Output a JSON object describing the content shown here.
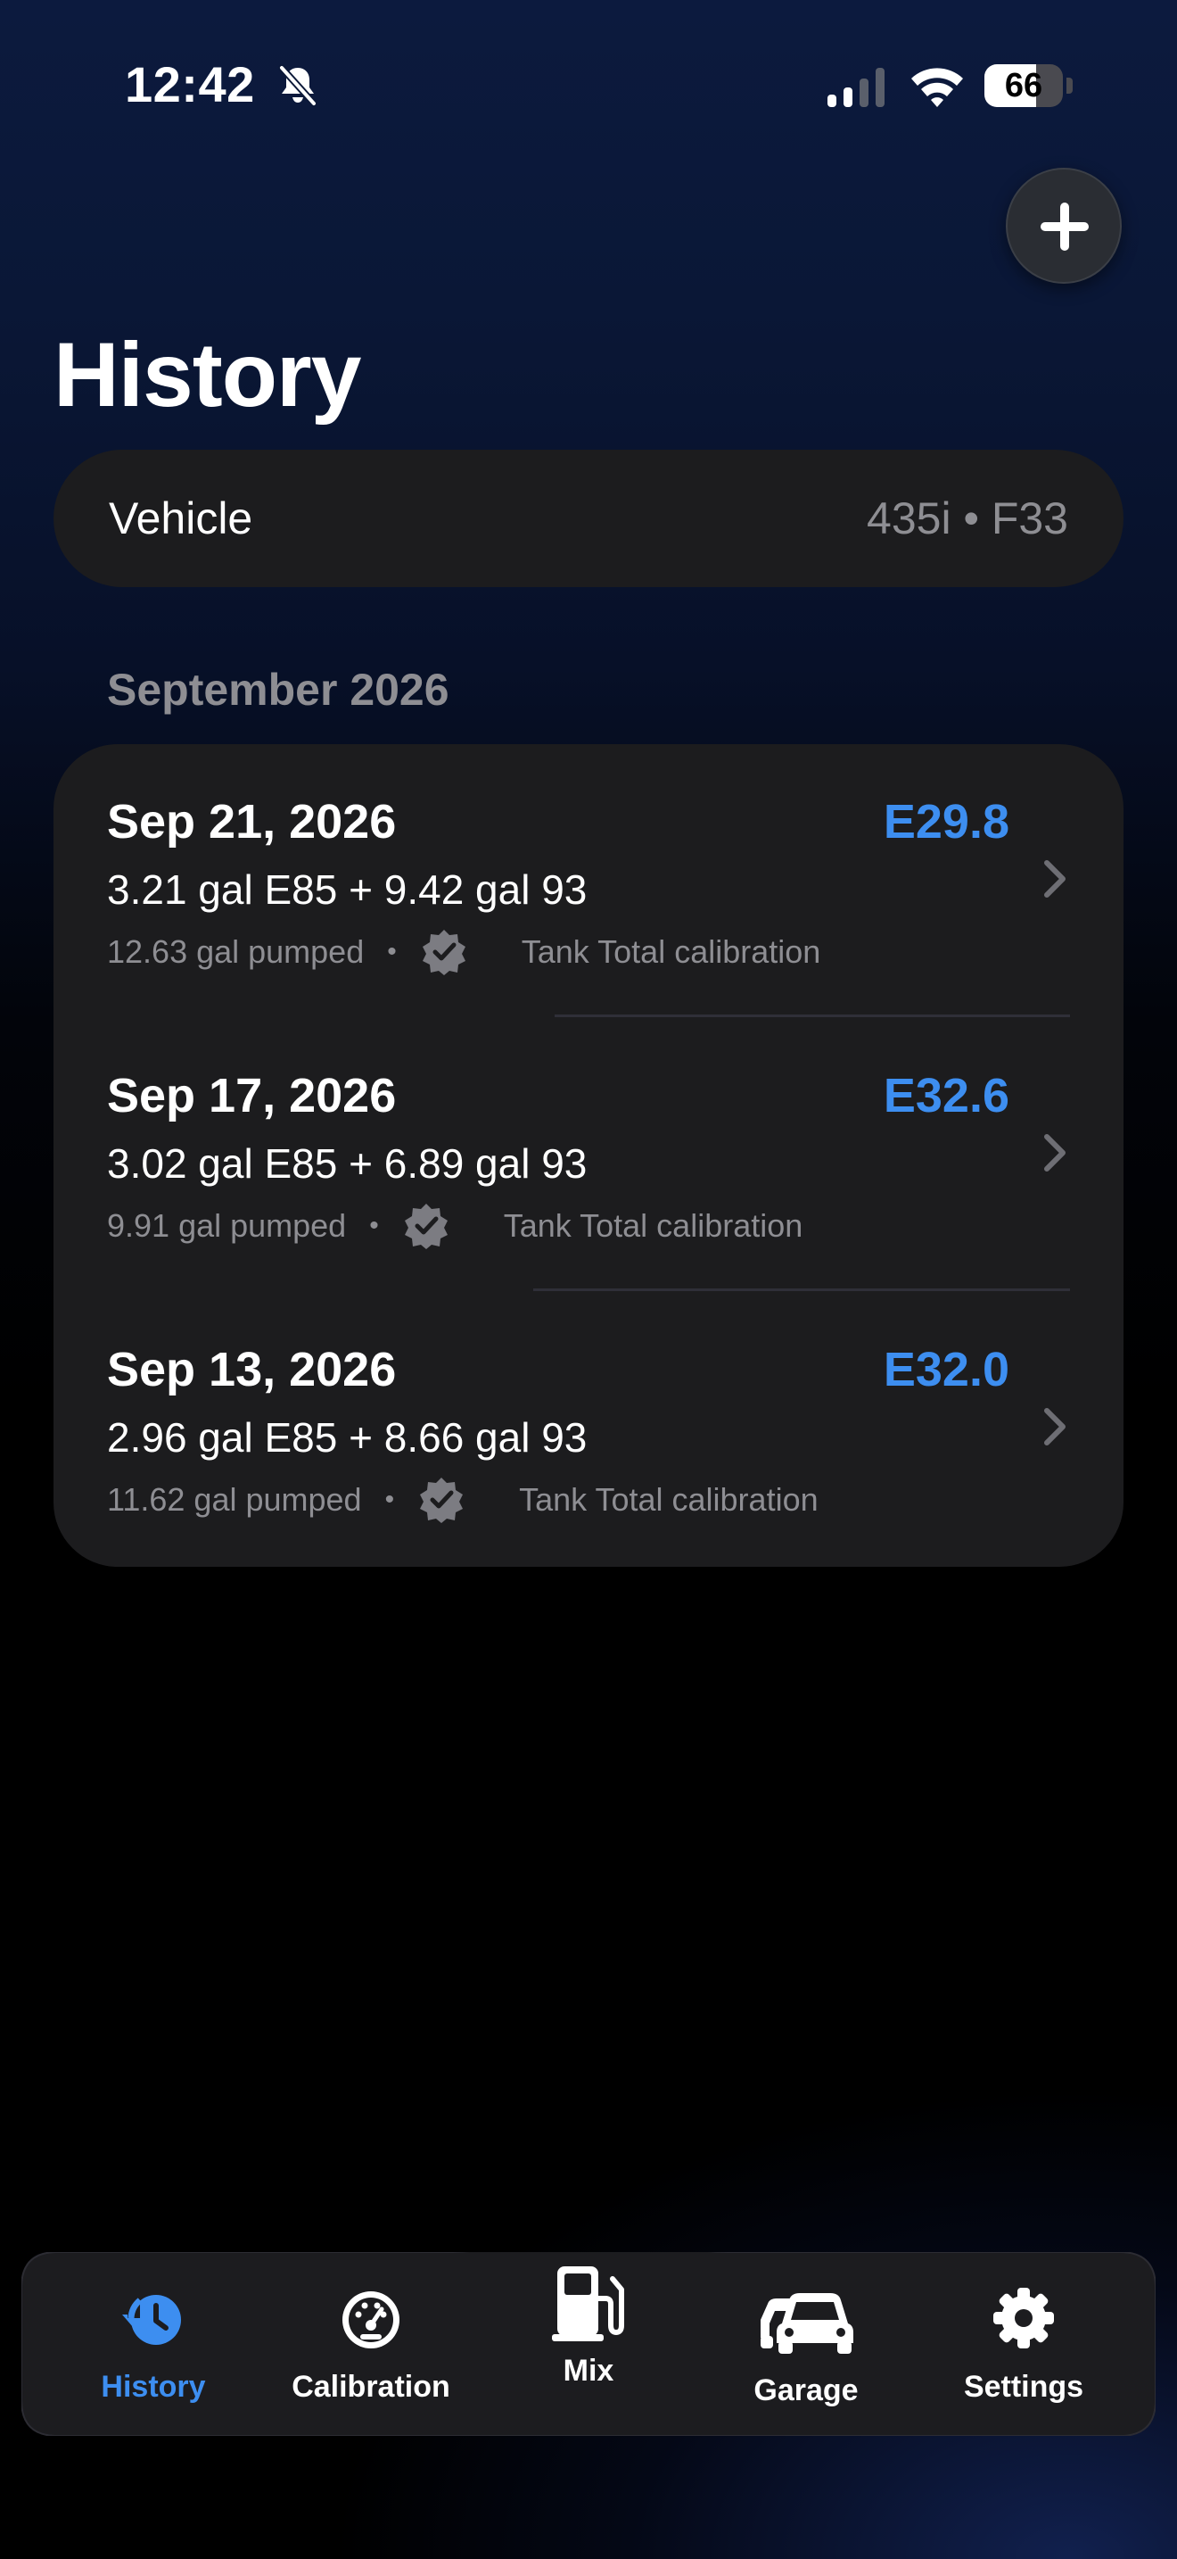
{
  "status_bar": {
    "time": "12:42",
    "battery_level": "66",
    "battery_fraction": 0.66
  },
  "icons": {
    "status": [
      "bell-slash-icon",
      "cellular-signal-icon",
      "wifi-icon",
      "battery-icon"
    ],
    "header": [
      "plus-icon"
    ],
    "entry": [
      "verified-badge-icon",
      "chevron-right-icon"
    ],
    "tabs": [
      "history-clock-icon",
      "gauge-icon",
      "fuel-pump-icon",
      "cars-icon",
      "gear-icon"
    ]
  },
  "colors": {
    "accent": "#3d8ef0",
    "card_background": "#1c1c1e",
    "secondary_text": "#8e8e93"
  },
  "header": {
    "title": "History"
  },
  "vehicle": {
    "label": "Vehicle",
    "value": "435i • F33"
  },
  "section": {
    "title": "September 2026"
  },
  "entries": [
    {
      "date": "Sep 21, 2026",
      "blend": "E29.8",
      "mix": "3.21 gal E85 + 9.42 gal 93",
      "pumped": "12.63 gal pumped",
      "separator": "•",
      "calibration": "Tank Total calibration"
    },
    {
      "date": "Sep 17, 2026",
      "blend": "E32.6",
      "mix": "3.02 gal E85 + 6.89 gal 93",
      "pumped": "9.91 gal pumped",
      "separator": "•",
      "calibration": "Tank Total calibration"
    },
    {
      "date": "Sep 13, 2026",
      "blend": "E32.0",
      "mix": "2.96 gal E85 + 8.66 gal 93",
      "pumped": "11.62 gal pumped",
      "separator": "•",
      "calibration": "Tank Total calibration"
    }
  ],
  "tabs": [
    {
      "label": "History",
      "icon": "history-clock-icon",
      "active": true
    },
    {
      "label": "Calibration",
      "icon": "gauge-icon",
      "active": false
    },
    {
      "label": "Mix",
      "icon": "fuel-pump-icon",
      "active": false
    },
    {
      "label": "Garage",
      "icon": "cars-icon",
      "active": false
    },
    {
      "label": "Settings",
      "icon": "gear-icon",
      "active": false
    }
  ]
}
